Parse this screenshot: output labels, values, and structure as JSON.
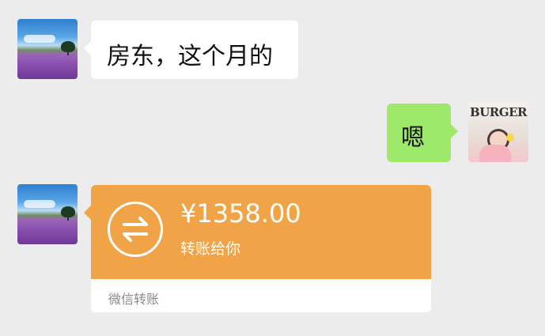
{
  "messages": [
    {
      "side": "left",
      "avatar": "landscape-avatar",
      "text": "房东，这个月的"
    },
    {
      "side": "right",
      "avatar": "burger-avatar",
      "text": "嗯"
    }
  ],
  "avatars": {
    "right_avatar_text": "BURGER"
  },
  "transfer": {
    "amount": "¥1358.00",
    "description": "转账给你",
    "footer": "微信转账",
    "icon": "transfer-arrows-icon"
  },
  "colors": {
    "background": "#ececec",
    "left_bubble": "#ffffff",
    "right_bubble": "#9ee86a",
    "transfer_orange": "#f0a447"
  }
}
